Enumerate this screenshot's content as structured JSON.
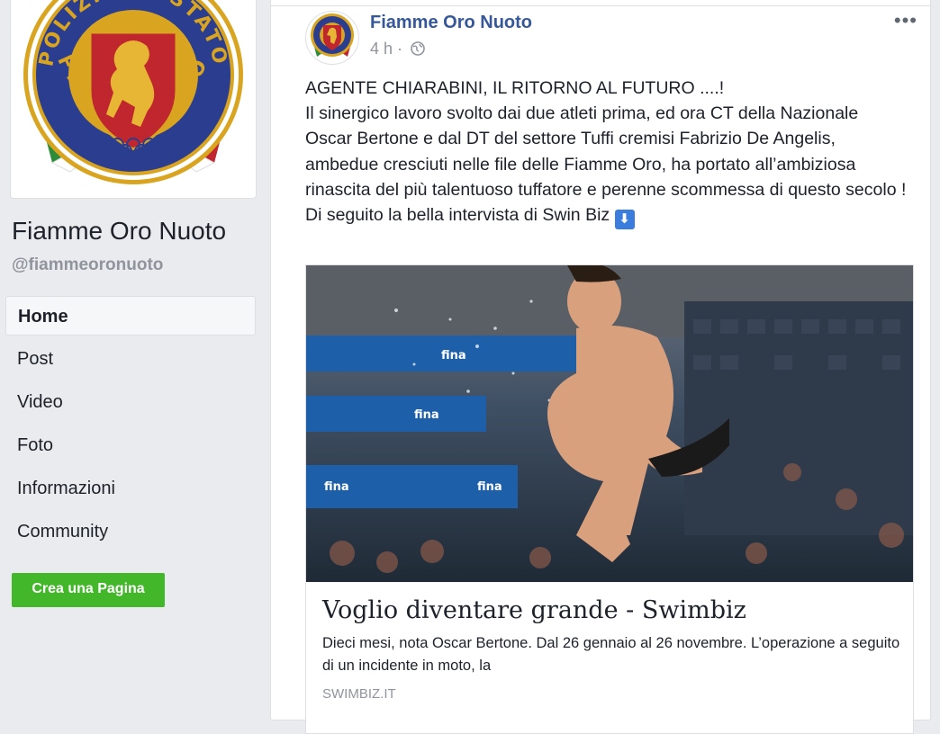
{
  "sidebar": {
    "page_name": "Fiamme Oro Nuoto",
    "handle": "@fiammeoronuoto",
    "nav": [
      {
        "label": "Home",
        "active": true
      },
      {
        "label": "Post"
      },
      {
        "label": "Video"
      },
      {
        "label": "Foto"
      },
      {
        "label": "Informazioni"
      },
      {
        "label": "Community"
      }
    ],
    "create_page_button": "Crea una Pagina",
    "logo_text": {
      "top": "POLIZIA DI STATO",
      "bottom": "FIAMME ORO"
    }
  },
  "post": {
    "author": "Fiamme Oro Nuoto",
    "time": "4 h",
    "separator": "·",
    "more_label": "•••",
    "text_lines": [
      "AGENTE CHIARABINI, IL RITORNO AL FUTURO ....!",
      "Il sinergico lavoro svolto dai due atleti prima, ed ora CT della Nazionale Oscar Bertone e dal DT del settore Tuffi cremisi Fabrizio De Angelis, ambedue cresciuti nelle file delle Fiamme Oro, ha portato all’ambiziosa rinascita del più talentuoso tuffatore e perenne scommessa di questo secolo !",
      "Di seguito la bella intervista di Swin Biz"
    ],
    "arrow_emoji": "⬇",
    "link": {
      "title": "Voglio diventare grande - Swimbiz",
      "description": "Dieci mesi, nota Oscar Bertone. Dal 26 gennaio al 26 novembre. L’operazione a seguito di un incidente in moto, la",
      "domain": "SWIMBIZ.IT",
      "image_banner_text": "fina"
    }
  },
  "colors": {
    "background": "#e9ebee",
    "link_blue": "#365899",
    "create_button": "#42b72a",
    "muted": "#90949c",
    "logo_red": "#c0262d",
    "logo_blue": "#2a3d8f",
    "logo_gold": "#d9a521"
  },
  "icons": [
    "globe-icon",
    "more-options-icon",
    "down-arrow-emoji"
  ]
}
